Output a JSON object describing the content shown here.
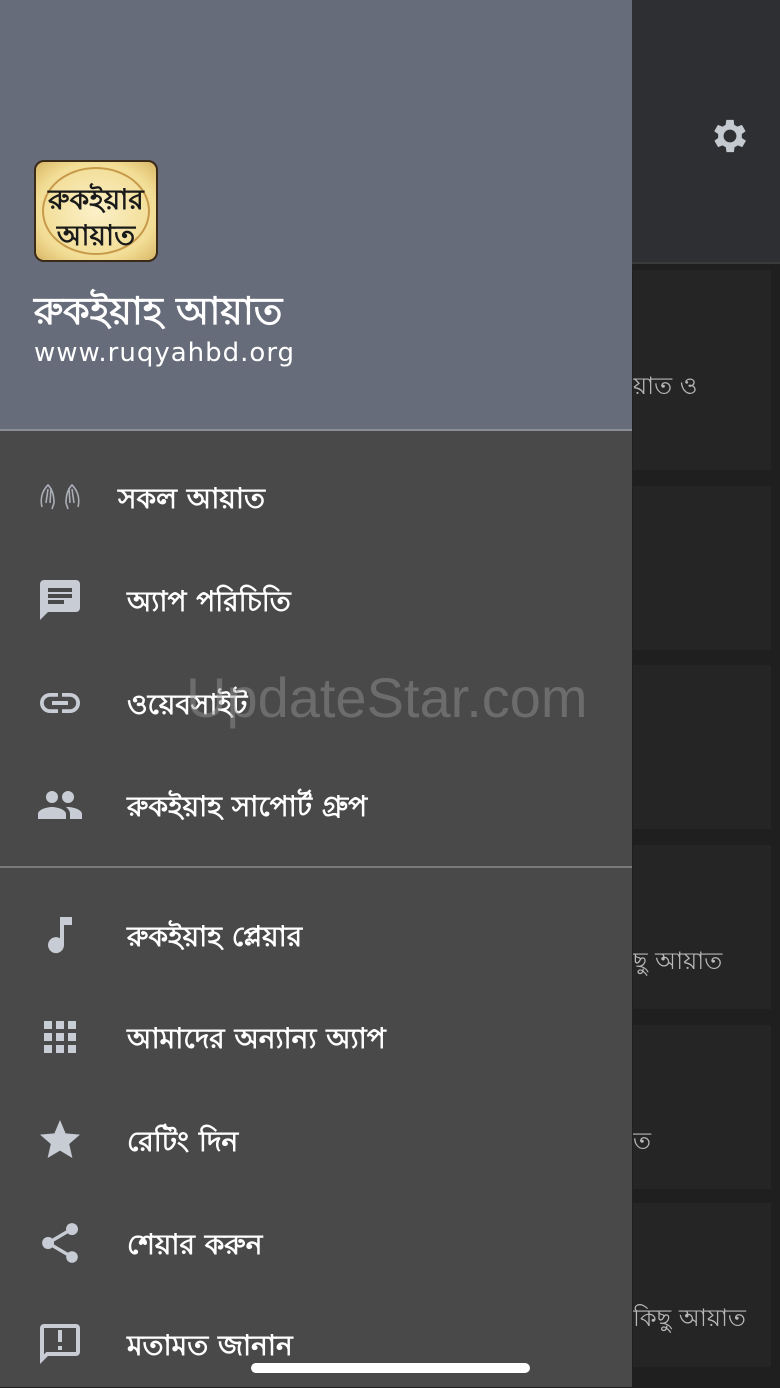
{
  "drawer": {
    "logo_line1": "রুকইয়ার",
    "logo_line2": "আয়াত",
    "app_name": "রুকইয়াহ আয়াত",
    "app_url": "www.ruqyahbd.org",
    "items": [
      {
        "icon": "praying-hands-icon",
        "label": "সকল আয়াত"
      },
      {
        "icon": "message-icon",
        "label": "অ্যাপ পরিচিতি"
      },
      {
        "icon": "link-icon",
        "label": "ওয়েবসাইট"
      },
      {
        "icon": "group-icon",
        "label": "রুকইয়াহ সাপোর্ট গ্রুপ"
      },
      {
        "icon": "music-note-icon",
        "label": "রুকইয়াহ প্লেয়ার"
      },
      {
        "icon": "apps-grid-icon",
        "label": "আমাদের অন্যান্য অ্যাপ"
      },
      {
        "icon": "star-icon",
        "label": "রেটিং দিন"
      },
      {
        "icon": "share-icon",
        "label": "শেয়ার করুন"
      },
      {
        "icon": "feedback-icon",
        "label": "মতামত জানান"
      }
    ]
  },
  "background": {
    "cards": [
      "য়াত ও",
      "",
      "",
      "ছু আয়াত",
      "ত",
      "কিছু আয়াত"
    ]
  },
  "watermark": "UpdateStar.com",
  "colors": {
    "header": "#666c7a",
    "drawer": "#4a494a",
    "icon": "#c8ccd4"
  }
}
